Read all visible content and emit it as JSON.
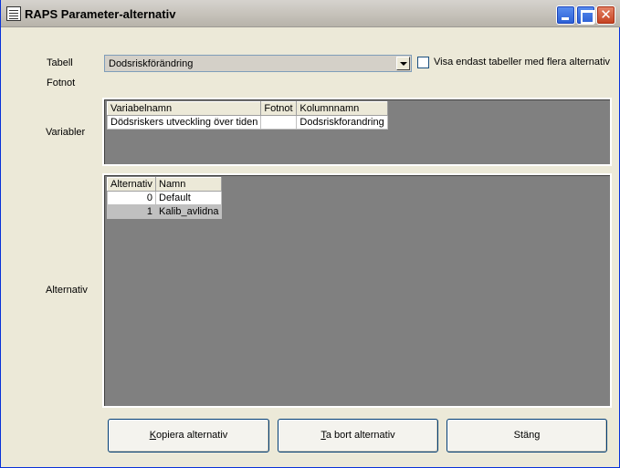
{
  "window": {
    "title": "RAPS Parameter-alternativ"
  },
  "form": {
    "tabell_label": "Tabell",
    "tabell_value": "Dodsriskförändring",
    "fotnot_label": "Fotnot",
    "checkbox_label": "Visa endast tabeller med flera alternativ",
    "checkbox_checked": false,
    "variabler_label": "Variabler",
    "alternativ_label": "Alternativ"
  },
  "variables_grid": {
    "columns": [
      "Variabelnamn",
      "Fotnot",
      "Kolumnnamn"
    ],
    "rows": [
      [
        "Dödsriskers utveckling över tiden",
        "",
        "Dodsriskforandring"
      ]
    ]
  },
  "alternatives_grid": {
    "columns": [
      "Alternativ",
      "Namn"
    ],
    "rows": [
      [
        "0",
        "Default"
      ],
      [
        "1",
        "Kalib_avlidna"
      ]
    ],
    "selected_row": 1
  },
  "buttons": {
    "copy": {
      "first": "K",
      "rest": "opiera alternativ"
    },
    "remove": {
      "first": "T",
      "rest": "a bort alternativ"
    },
    "close": "Stäng"
  }
}
